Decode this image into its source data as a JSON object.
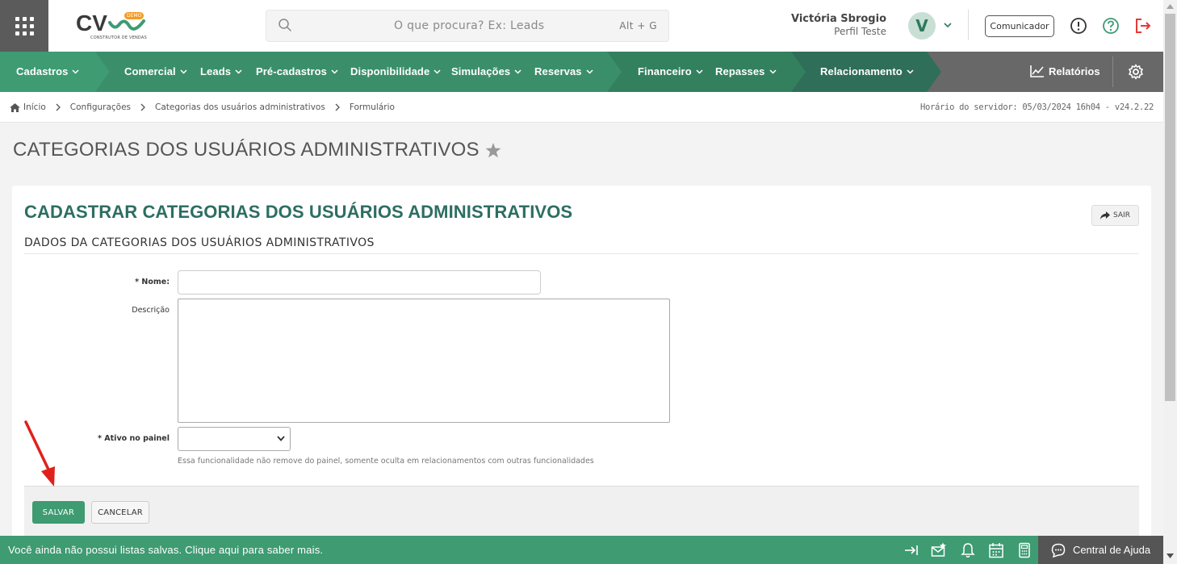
{
  "header": {
    "logo_text": "CV",
    "logo_badge": "DEMO",
    "logo_subtitle": "CONSTRUTOR DE VENDAS",
    "search_placeholder": "O que procura? Ex: Leads",
    "search_shortcut": "Alt + G",
    "user_name": "Victória Sbrogio",
    "user_profile": "Perfil Teste",
    "avatar_initial": "V",
    "comunicador_label": "Comunicador"
  },
  "nav": {
    "items": [
      {
        "label": "Cadastros"
      },
      {
        "label": "Comercial"
      },
      {
        "label": "Leads"
      },
      {
        "label": "Pré-cadastros"
      },
      {
        "label": "Disponibilidade"
      },
      {
        "label": "Simulações"
      },
      {
        "label": "Reservas"
      },
      {
        "label": "Financeiro"
      },
      {
        "label": "Repasses"
      },
      {
        "label": "Relacionamento"
      }
    ],
    "reports_label": "Relatórios",
    "colors": {
      "green_light": "#3e9b72",
      "green_mid": "#3a8f6a",
      "green_dark": "#2f6e58",
      "gray": "#686868"
    }
  },
  "breadcrumb": {
    "items": [
      "Início",
      "Configurações",
      "Categorias dos usuários administrativos",
      "Formulário"
    ],
    "server_time": "Horário do servidor: 05/03/2024 16h04 - v24.2.22"
  },
  "page": {
    "title": "CATEGORIAS DOS USUÁRIOS ADMINISTRATIVOS"
  },
  "form": {
    "card_title": "CADASTRAR CATEGORIAS DOS USUÁRIOS ADMINISTRATIVOS",
    "exit_label": "SAIR",
    "section_title": "DADOS DA CATEGORIAS DOS USUÁRIOS ADMINISTRATIVOS",
    "nome_label": "* Nome:",
    "nome_value": "",
    "descricao_label": "Descrição",
    "descricao_value": "",
    "ativo_label": "* Ativo no painel",
    "ativo_value": "",
    "ativo_help": "Essa funcionalidade não remove do painel, somente oculta em relacionamentos com outras funcionalidades",
    "save_label": "SALVAR",
    "cancel_label": "CANCELAR"
  },
  "bottom_bar": {
    "message": "Você ainda não possui listas salvas. Clique aqui para saber mais.",
    "help_center_label": "Central de Ajuda"
  },
  "icons": {
    "apps": "apps-grid-icon",
    "search": "search-icon",
    "info": "info-icon",
    "help": "help-icon",
    "logout": "logout-icon",
    "reports": "chart-line-icon",
    "settings": "gear-icon",
    "home": "home-icon",
    "star": "star-icon",
    "exit": "share-arrow-icon"
  }
}
